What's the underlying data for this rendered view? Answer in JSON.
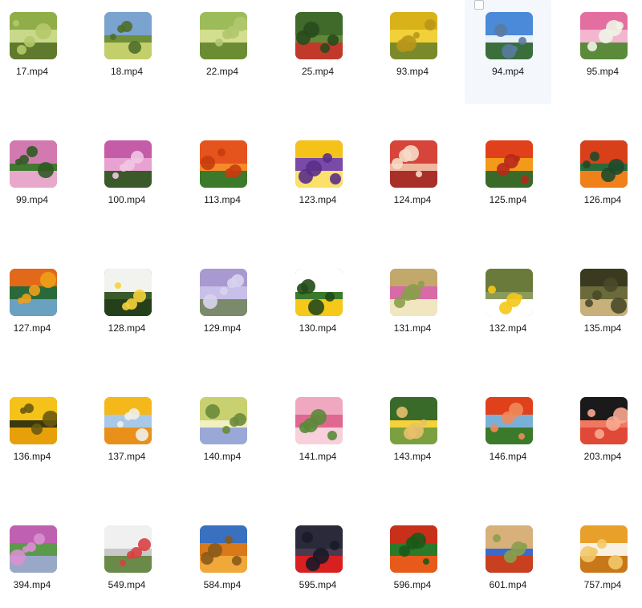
{
  "files": [
    {
      "name": "17.mp4",
      "icon": "video-thumbnail-icon"
    },
    {
      "name": "18.mp4",
      "icon": "video-thumbnail-icon"
    },
    {
      "name": "22.mp4",
      "icon": "video-thumbnail-icon"
    },
    {
      "name": "25.mp4",
      "icon": "video-thumbnail-icon"
    },
    {
      "name": "93.mp4",
      "icon": "video-thumbnail-icon"
    },
    {
      "name": "94.mp4",
      "icon": "video-thumbnail-icon",
      "hovered": true
    },
    {
      "name": "95.mp4",
      "icon": "video-thumbnail-icon"
    },
    {
      "name": "99.mp4",
      "icon": "video-thumbnail-icon"
    },
    {
      "name": "100.mp4",
      "icon": "video-thumbnail-icon"
    },
    {
      "name": "113.mp4",
      "icon": "video-thumbnail-icon"
    },
    {
      "name": "123.mp4",
      "icon": "video-thumbnail-icon"
    },
    {
      "name": "124.mp4",
      "icon": "video-thumbnail-icon"
    },
    {
      "name": "125.mp4",
      "icon": "video-thumbnail-icon"
    },
    {
      "name": "126.mp4",
      "icon": "video-thumbnail-icon"
    },
    {
      "name": "127.mp4",
      "icon": "video-thumbnail-icon"
    },
    {
      "name": "128.mp4",
      "icon": "video-thumbnail-icon"
    },
    {
      "name": "129.mp4",
      "icon": "video-thumbnail-icon"
    },
    {
      "name": "130.mp4",
      "icon": "video-thumbnail-icon"
    },
    {
      "name": "131.mp4",
      "icon": "video-thumbnail-icon"
    },
    {
      "name": "132.mp4",
      "icon": "video-thumbnail-icon"
    },
    {
      "name": "135.mp4",
      "icon": "video-thumbnail-icon"
    },
    {
      "name": "136.mp4",
      "icon": "video-thumbnail-icon"
    },
    {
      "name": "137.mp4",
      "icon": "video-thumbnail-icon"
    },
    {
      "name": "140.mp4",
      "icon": "video-thumbnail-icon"
    },
    {
      "name": "141.mp4",
      "icon": "video-thumbnail-icon"
    },
    {
      "name": "143.mp4",
      "icon": "video-thumbnail-icon"
    },
    {
      "name": "146.mp4",
      "icon": "video-thumbnail-icon"
    },
    {
      "name": "203.mp4",
      "icon": "video-thumbnail-icon"
    },
    {
      "name": "394.mp4",
      "icon": "video-thumbnail-icon"
    },
    {
      "name": "549.mp4",
      "icon": "video-thumbnail-icon"
    },
    {
      "name": "584.mp4",
      "icon": "video-thumbnail-icon"
    },
    {
      "name": "595.mp4",
      "icon": "video-thumbnail-icon"
    },
    {
      "name": "596.mp4",
      "icon": "video-thumbnail-icon"
    },
    {
      "name": "601.mp4",
      "icon": "video-thumbnail-icon"
    },
    {
      "name": "757.mp4",
      "icon": "video-thumbnail-icon"
    }
  ],
  "colors": {
    "hover_background": "#f4f7fb",
    "label_text": "#1a1a1a"
  }
}
